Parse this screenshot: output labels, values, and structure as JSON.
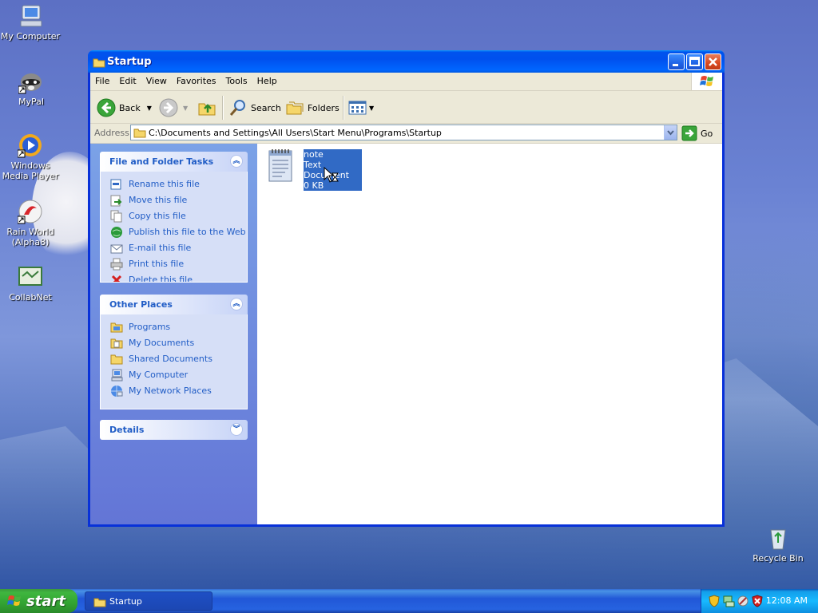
{
  "desktop": {
    "icons": [
      {
        "label": "My Computer",
        "icon": "computer-icon"
      },
      {
        "label": "MyPal",
        "icon": "raccoon-icon"
      },
      {
        "label": "Windows Media Player",
        "icon": "media-player-icon"
      },
      {
        "label": "Rain World (Alpha8)",
        "icon": "app-shortcut-icon"
      },
      {
        "label": "CollabNet",
        "icon": "collabnet-icon"
      },
      {
        "label": "Recycle Bin",
        "icon": "recycle-bin-icon"
      }
    ]
  },
  "window": {
    "title": "Startup",
    "menu": [
      "File",
      "Edit",
      "View",
      "Favorites",
      "Tools",
      "Help"
    ],
    "toolbar": {
      "back": "Back",
      "search": "Search",
      "folders": "Folders"
    },
    "address": {
      "label": "Address",
      "path": "C:\\Documents and Settings\\All Users\\Start Menu\\Programs\\Startup",
      "go": "Go"
    },
    "task_pane": {
      "file_tasks": {
        "title": "File and Folder Tasks",
        "items": [
          {
            "label": "Rename this file",
            "icon": "rename-icon"
          },
          {
            "label": "Move this file",
            "icon": "move-icon"
          },
          {
            "label": "Copy this file",
            "icon": "copy-icon"
          },
          {
            "label": "Publish this file to the Web",
            "icon": "publish-web-icon"
          },
          {
            "label": "E-mail this file",
            "icon": "email-icon"
          },
          {
            "label": "Print this file",
            "icon": "print-icon"
          },
          {
            "label": "Delete this file",
            "icon": "delete-icon"
          }
        ]
      },
      "other_places": {
        "title": "Other Places",
        "items": [
          {
            "label": "Programs",
            "icon": "folder-icon"
          },
          {
            "label": "My Documents",
            "icon": "folder-icon"
          },
          {
            "label": "Shared Documents",
            "icon": "folder-icon"
          },
          {
            "label": "My Computer",
            "icon": "computer-icon"
          },
          {
            "label": "My Network Places",
            "icon": "network-icon"
          }
        ]
      },
      "details": {
        "title": "Details"
      }
    },
    "files": [
      {
        "name": "note",
        "type": "Text Document",
        "size": "0 KB",
        "selected": true
      }
    ]
  },
  "taskbar": {
    "start": "start",
    "tasks": [
      "Startup"
    ],
    "clock": "12:08 AM"
  },
  "colors": {
    "title_blue": "#0054e3",
    "task_link": "#215dc6",
    "selection": "#316ac5",
    "start_green": "#3fb63f"
  }
}
